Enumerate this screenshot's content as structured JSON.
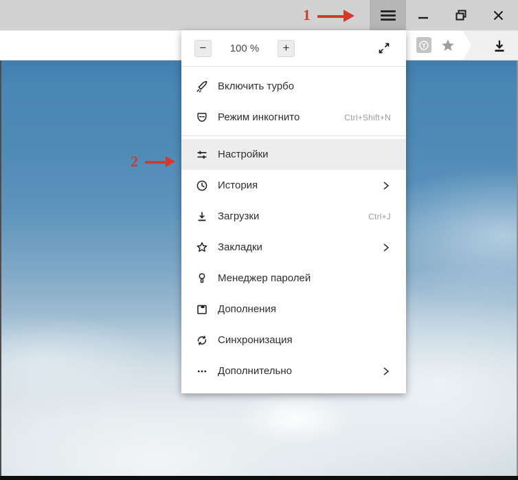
{
  "zoom_controls": {
    "decrease": "−",
    "value": "100 %",
    "increase": "+"
  },
  "address_bar": {
    "protect_letter": "Y"
  },
  "menu": {
    "items": [
      {
        "icon": "turbo-rocket-icon",
        "label": "Включить турбо"
      },
      {
        "icon": "incognito-mask-icon",
        "label": "Режим инкогнито",
        "shortcut": "Ctrl+Shift+N"
      },
      {
        "icon": "settings-sliders-icon",
        "label": "Настройки",
        "highlighted": true
      },
      {
        "icon": "history-clock-icon",
        "label": "История",
        "has_submenu": true
      },
      {
        "icon": "downloads-arrow-icon",
        "label": "Загрузки",
        "shortcut": "Ctrl+J"
      },
      {
        "icon": "bookmarks-star-icon",
        "label": "Закладки",
        "has_submenu": true
      },
      {
        "icon": "password-key-icon",
        "label": "Менеджер паролей"
      },
      {
        "icon": "addons-box-icon",
        "label": "Дополнения"
      },
      {
        "icon": "sync-arrows-icon",
        "label": "Синхронизация"
      },
      {
        "icon": "more-dots-icon",
        "label": "Дополнительно",
        "has_submenu": true
      }
    ]
  },
  "annotations": {
    "step1_label": "1",
    "step2_label": "2",
    "arrow_color": "#d6372c"
  },
  "colors": {
    "titlebar": "#d2d2d2",
    "hamburger_bg": "#b5b5b5",
    "menu_highlight": "#ededed",
    "sky_top": "#4886b4",
    "sky_bottom": "#ccd7dd"
  }
}
